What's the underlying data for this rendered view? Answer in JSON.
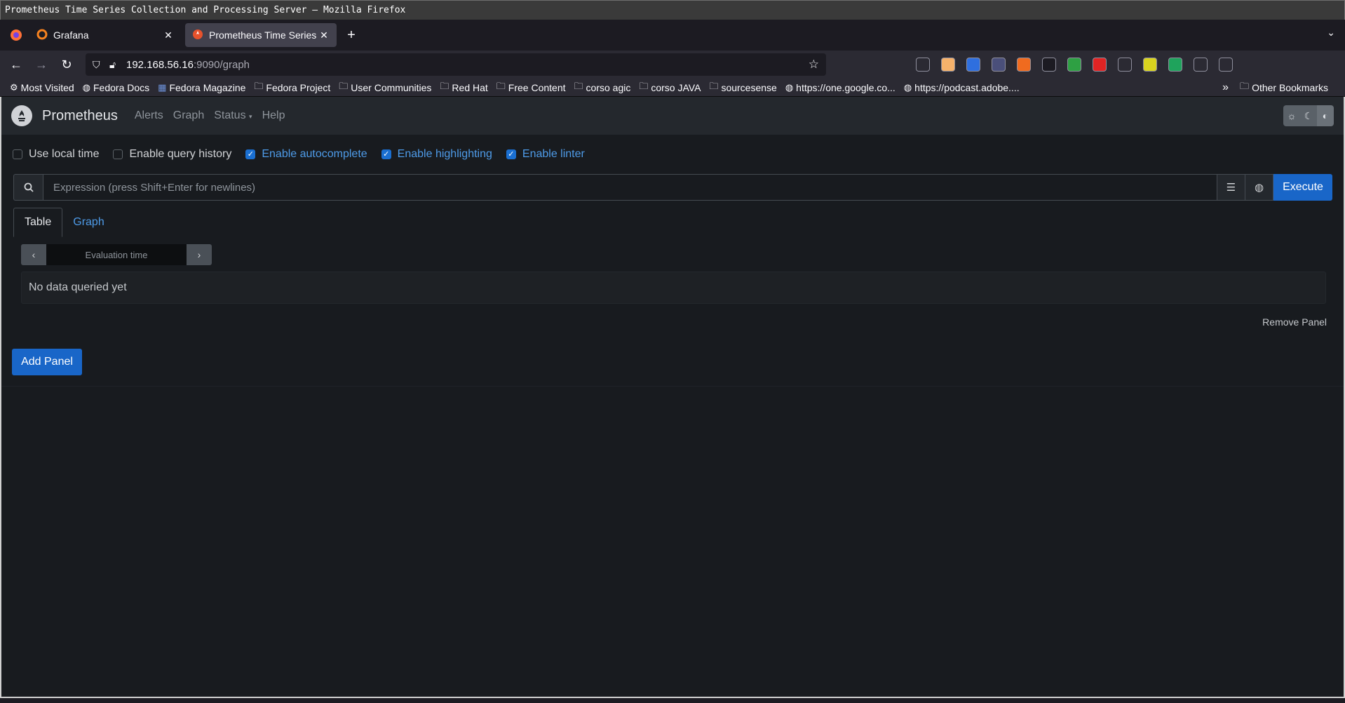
{
  "window": {
    "title": "Prometheus Time Series Collection and Processing Server — Mozilla Firefox"
  },
  "browser": {
    "tabs": [
      {
        "title": "Grafana",
        "active": false
      },
      {
        "title": "Prometheus Time Series C",
        "active": true
      }
    ],
    "url": {
      "host": "192.168.56.16",
      "path": ":9090/graph"
    },
    "bookmarks": [
      {
        "label": "Most Visited",
        "icon": "gear-icon"
      },
      {
        "label": "Fedora Docs",
        "icon": "globe-icon"
      },
      {
        "label": "Fedora Magazine",
        "icon": "fm-icon"
      },
      {
        "label": "Fedora Project",
        "icon": "folder-icon"
      },
      {
        "label": "User Communities",
        "icon": "folder-icon"
      },
      {
        "label": "Red Hat",
        "icon": "folder-icon"
      },
      {
        "label": "Free Content",
        "icon": "folder-icon"
      },
      {
        "label": "corso agic",
        "icon": "folder-icon"
      },
      {
        "label": "corso JAVA",
        "icon": "folder-icon"
      },
      {
        "label": "sourcesense",
        "icon": "folder-icon"
      },
      {
        "label": "https://one.google.co...",
        "icon": "globe-icon"
      },
      {
        "label": "https://podcast.adobe....",
        "icon": "globe-icon"
      }
    ],
    "other_bookmarks": "Other Bookmarks",
    "extension_colors": [
      "#2b2a33",
      "#f6b26b",
      "#2f6fdf",
      "#4a4f7a",
      "#f06b1f",
      "#1c1b22",
      "#2ea043",
      "#e02424",
      "#2b2a33",
      "#d8d31f",
      "#1fa35c",
      "#2b2a33",
      "#2b2a33"
    ]
  },
  "prometheus": {
    "brand": "Prometheus",
    "nav": {
      "alerts": "Alerts",
      "graph": "Graph",
      "status": "Status",
      "help": "Help"
    },
    "options": {
      "local_time": "Use local time",
      "query_history": "Enable query history",
      "autocomplete": "Enable autocomplete",
      "highlighting": "Enable highlighting",
      "linter": "Enable linter"
    },
    "expression_placeholder": "Expression (press Shift+Enter for newlines)",
    "execute": "Execute",
    "tabs": {
      "table": "Table",
      "graph": "Graph"
    },
    "eval_placeholder": "Evaluation time",
    "no_data": "No data queried yet",
    "remove_panel": "Remove Panel",
    "add_panel": "Add Panel",
    "accent": "#1966c8",
    "link_color": "#4e9be8"
  }
}
